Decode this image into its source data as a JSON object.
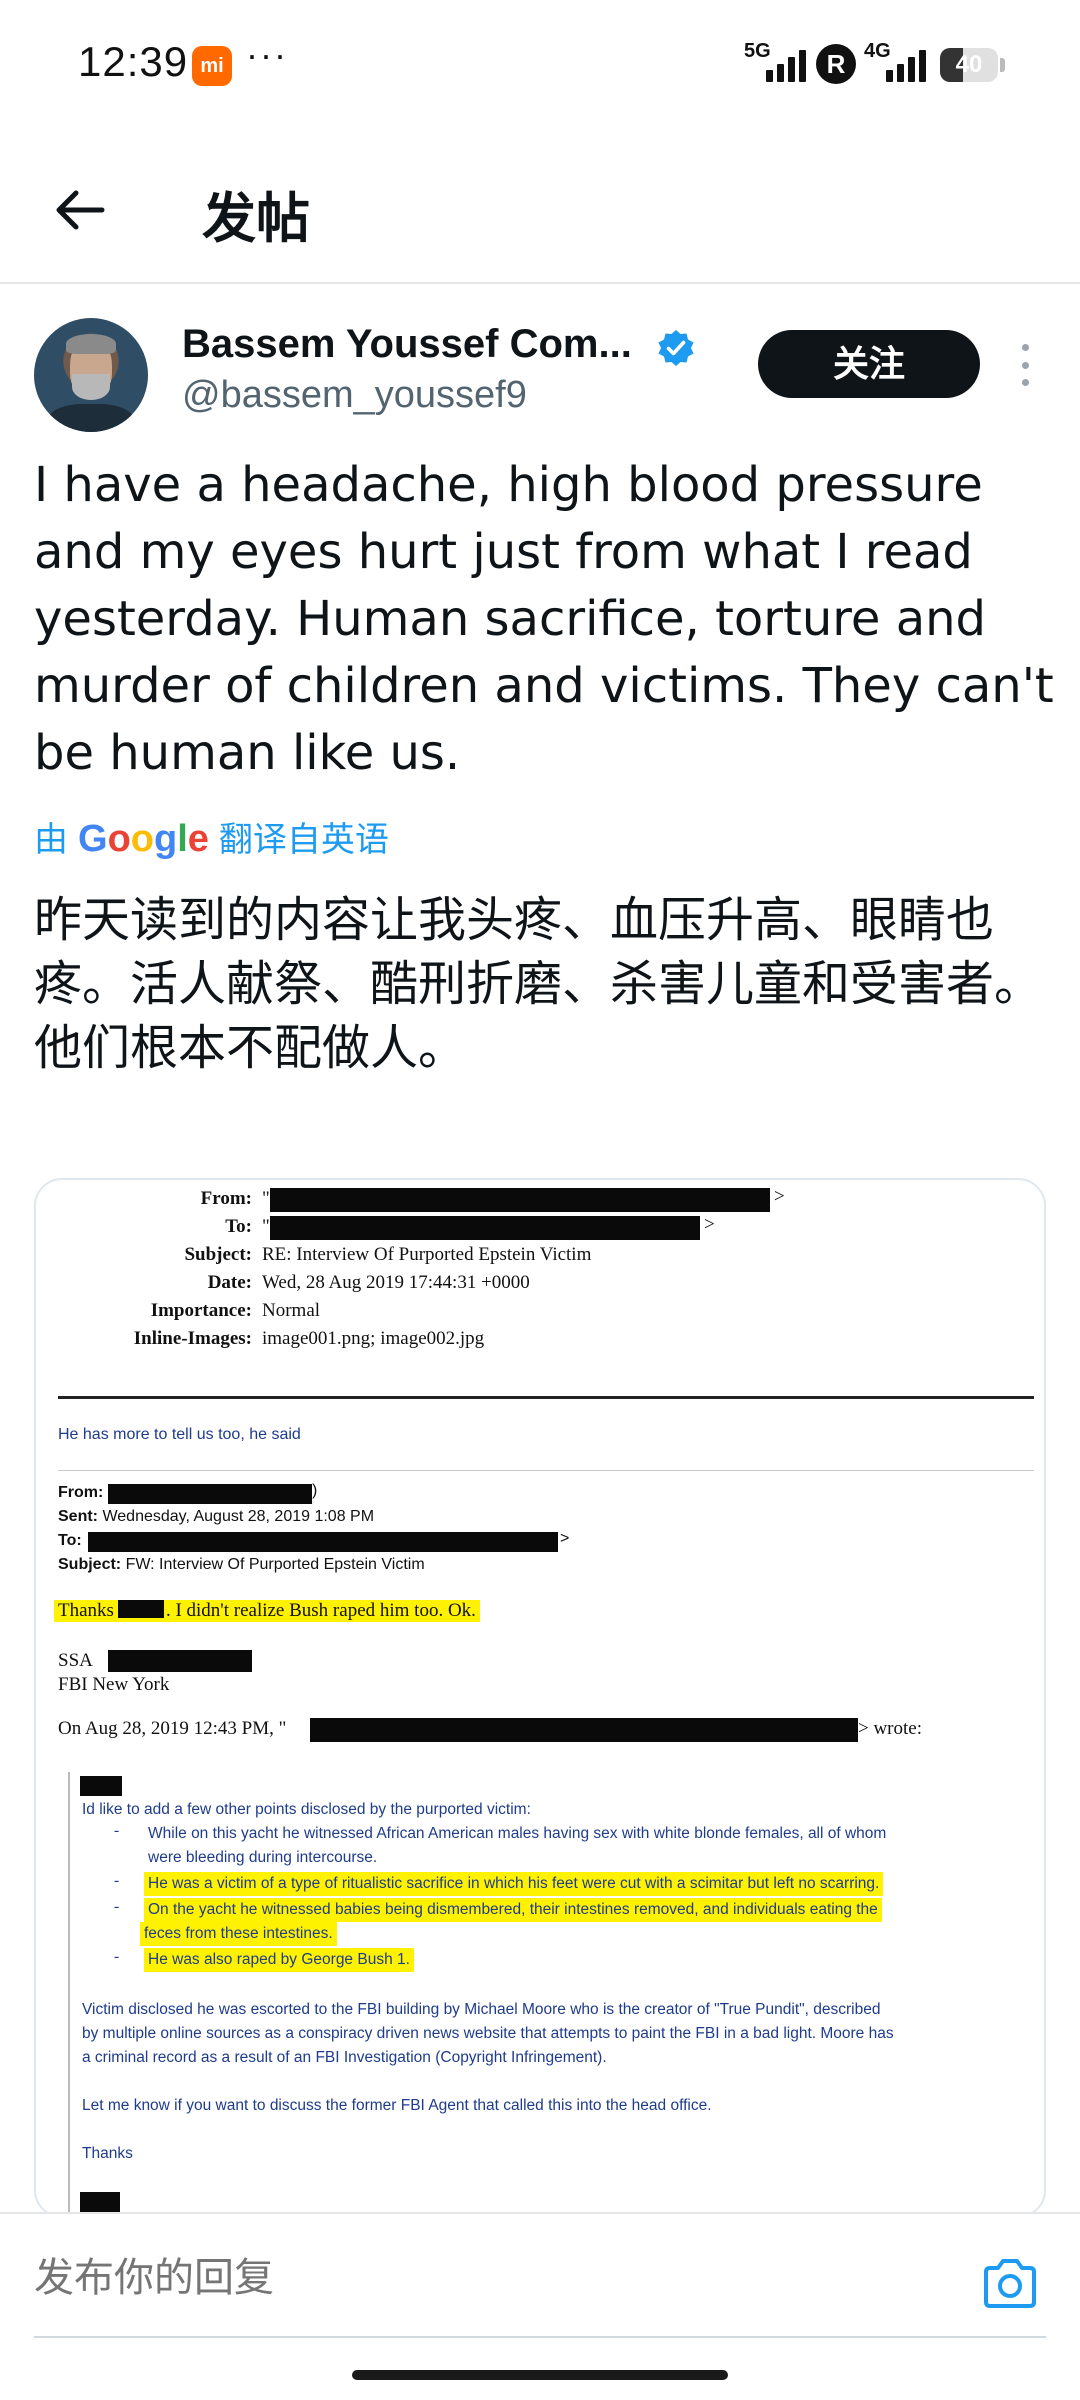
{
  "status_bar": {
    "time": "12:39",
    "mi_label": "mi",
    "more": "···",
    "net1": "5G",
    "roaming": "R",
    "net2": "4G",
    "battery": "40",
    "battery_level": 0.4
  },
  "header": {
    "title": "发帖",
    "back_icon": "arrow-left-icon"
  },
  "tweet": {
    "display_name": "Bassem Youssef Com...",
    "handle": "@bassem_youssef9",
    "follow_label": "关注",
    "text": "I have a headache, high blood pressure and my eyes hurt just from what I read yesterday. Human sacrifice, torture and murder of children and victims. They can't be human like us.",
    "translate_prefix": "由",
    "translate_brand": "Google",
    "translate_suffix": "翻译自英语",
    "translated_text": "昨天读到的内容让我头疼、血压升高、眼睛也疼。活人献祭、酷刑折磨、杀害儿童和受害者。他们根本不配做人。",
    "verified_color": "#1d9bf0"
  },
  "document": {
    "from_label": "From:",
    "to_label": "To:",
    "subject_label": "Subject:",
    "subject_value": "RE: Interview Of Purported Epstein Victim",
    "date_label": "Date:",
    "date_value": "Wed, 28 Aug 2019 17:44:31 +0000",
    "importance_label": "Importance:",
    "importance_value": "Normal",
    "inline_images_label": "Inline-Images:",
    "inline_images_value": "image001.png; image002.jpg",
    "note": "He has more to tell us too, he said",
    "fw_from_label": "From:",
    "fw_sent_label": "Sent:",
    "fw_sent_value": "Wednesday, August 28, 2019 1:08 PM",
    "fw_to_label": "To:",
    "fw_subject_label": "Subject:",
    "fw_subject_value": "FW: Interview Of Purported Epstein Victim",
    "thanks_prefix": "Thanks",
    "thanks_suffix": ". I didn't realize Bush raped him too. Ok.",
    "ssa": "SSA",
    "office": "FBI New York",
    "on_date_prefix": "On Aug 28, 2019 12:43 PM, \"",
    "on_date_suffix": "> wrote:",
    "intro": "Id like to add a few other points disclosed by the purported victim:",
    "bullet1a": "While on this yacht he witnessed African American males having sex with white blonde females, all of whom",
    "bullet1b": "were bleeding during intercourse.",
    "bullet2": "He was a victim of a type of ritualistic sacrifice in which his feet were cut with a scimitar but left no scarring.",
    "bullet3a": "On the yacht he witnessed babies being dismembered, their intestines removed, and individuals eating the",
    "bullet3b": "feces from these intestines.",
    "bullet4": "He was also raped by George Bush 1.",
    "para1a": "Victim disclosed he was escorted to the FBI building by Michael Moore who is the creator of \"True Pundit\", described",
    "para1b": "by multiple online sources as a conspiracy driven news website that attempts to paint the FBI in a bad light. Moore has",
    "para1c": "a criminal record as a result of an FBI Investigation (Copyright Infringement).",
    "para2": "Let me know if you want to discuss the former FBI Agent that called this into the head office.",
    "closing": "Thanks",
    "highlight_color": "#fff200"
  },
  "reply": {
    "placeholder": "发布你的回复",
    "camera_icon": "camera-icon"
  }
}
